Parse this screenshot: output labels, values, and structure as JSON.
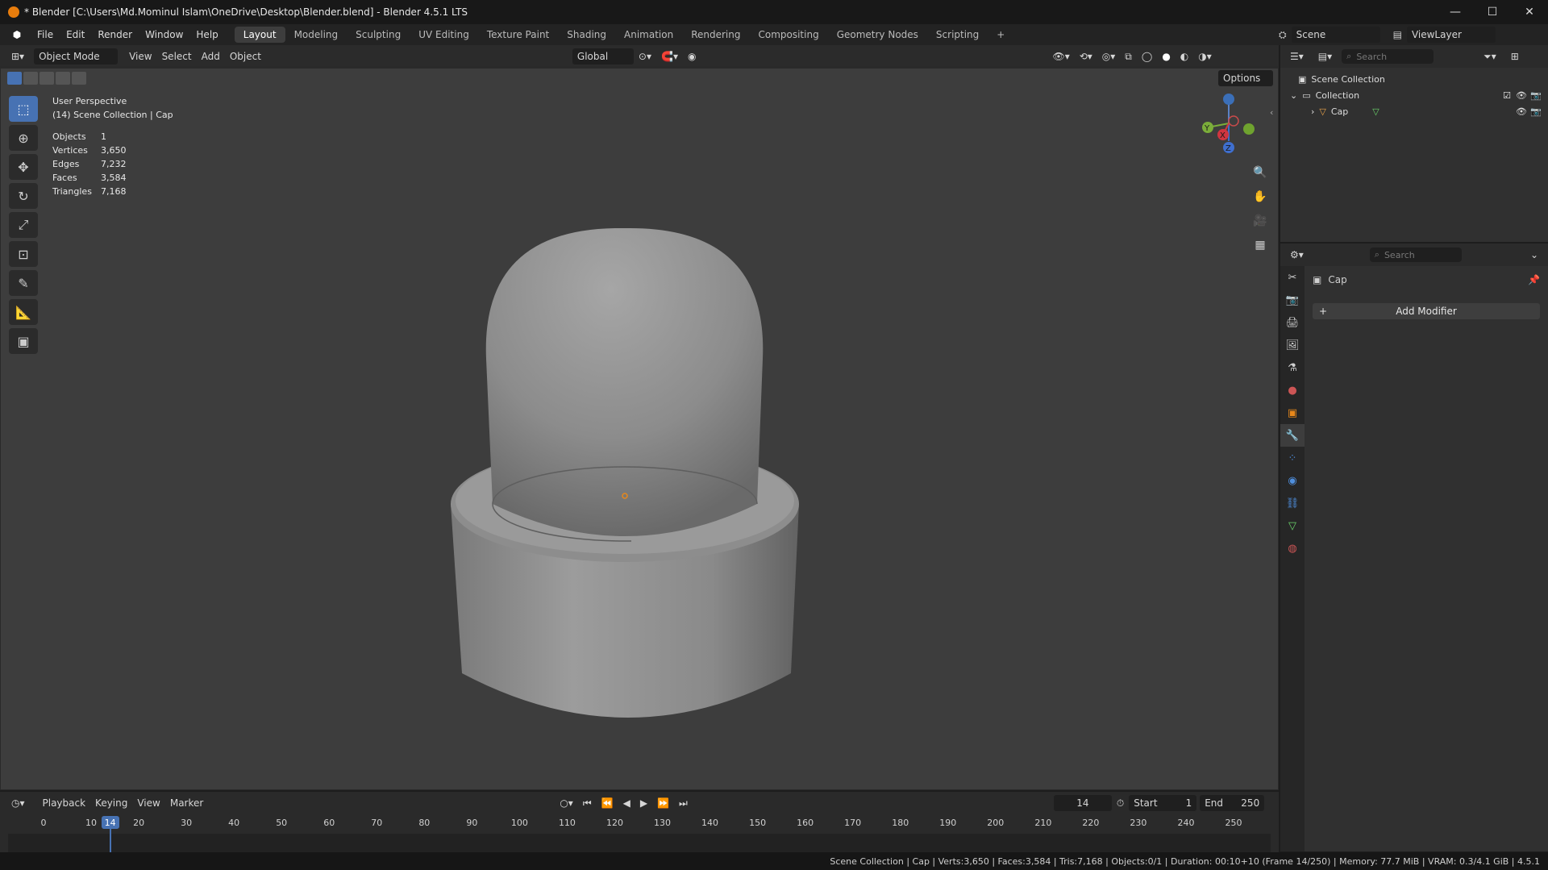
{
  "window": {
    "title": "* Blender [C:\\Users\\Md.Mominul Islam\\OneDrive\\Desktop\\Blender.blend] - Blender 4.5.1 LTS",
    "minimize": "—",
    "maximize": "☐",
    "close": "✕"
  },
  "menu": [
    "File",
    "Edit",
    "Render",
    "Window",
    "Help"
  ],
  "workspaces": [
    {
      "label": "Layout",
      "active": true
    },
    {
      "label": "Modeling"
    },
    {
      "label": "Sculpting"
    },
    {
      "label": "UV Editing"
    },
    {
      "label": "Texture Paint"
    },
    {
      "label": "Shading"
    },
    {
      "label": "Animation"
    },
    {
      "label": "Rendering"
    },
    {
      "label": "Compositing"
    },
    {
      "label": "Geometry Nodes"
    },
    {
      "label": "Scripting"
    }
  ],
  "add_workspace": "+",
  "scene": {
    "label": "Scene",
    "view_layer": "ViewLayer"
  },
  "viewport_header": {
    "mode": "Object Mode",
    "view": "View",
    "select": "Select",
    "add": "Add",
    "object": "Object",
    "transform": "Global",
    "options": "Options"
  },
  "overlay_info": {
    "perspective": "User Perspective",
    "collection": "(14) Scene Collection | Cap",
    "stats": [
      {
        "k": "Objects",
        "v": "1"
      },
      {
        "k": "Vertices",
        "v": "3,650"
      },
      {
        "k": "Edges",
        "v": "7,232"
      },
      {
        "k": "Faces",
        "v": "3,584"
      },
      {
        "k": "Triangles",
        "v": "7,168"
      }
    ]
  },
  "gizmo": {
    "x": "X",
    "y": "Y",
    "z": "Z"
  },
  "timeline": {
    "playback": "Playback",
    "keying": "Keying",
    "view": "View",
    "marker": "Marker",
    "current_frame": "14",
    "start_label": "Start",
    "start": "1",
    "end_label": "End",
    "end": "250",
    "ticks": [
      "0",
      "10",
      "20",
      "30",
      "40",
      "50",
      "60",
      "70",
      "80",
      "90",
      "100",
      "110",
      "120",
      "130",
      "140",
      "150",
      "160",
      "170",
      "180",
      "190",
      "200",
      "210",
      "220",
      "230",
      "240",
      "250"
    ],
    "playhead": "14"
  },
  "outliner": {
    "search_placeholder": "Search",
    "scene_collection": "Scene Collection",
    "collection": "Collection",
    "object": "Cap"
  },
  "properties": {
    "search_placeholder": "Search",
    "object": "Cap",
    "add_modifier": "Add Modifier"
  },
  "status": "Scene Collection | Cap | Verts:3,650 | Faces:3,584 | Tris:7,168 | Objects:0/1 | Duration: 00:10+10 (Frame 14/250) | Memory: 77.7 MiB | VRAM: 0.3/4.1 GiB | 4.5.1"
}
